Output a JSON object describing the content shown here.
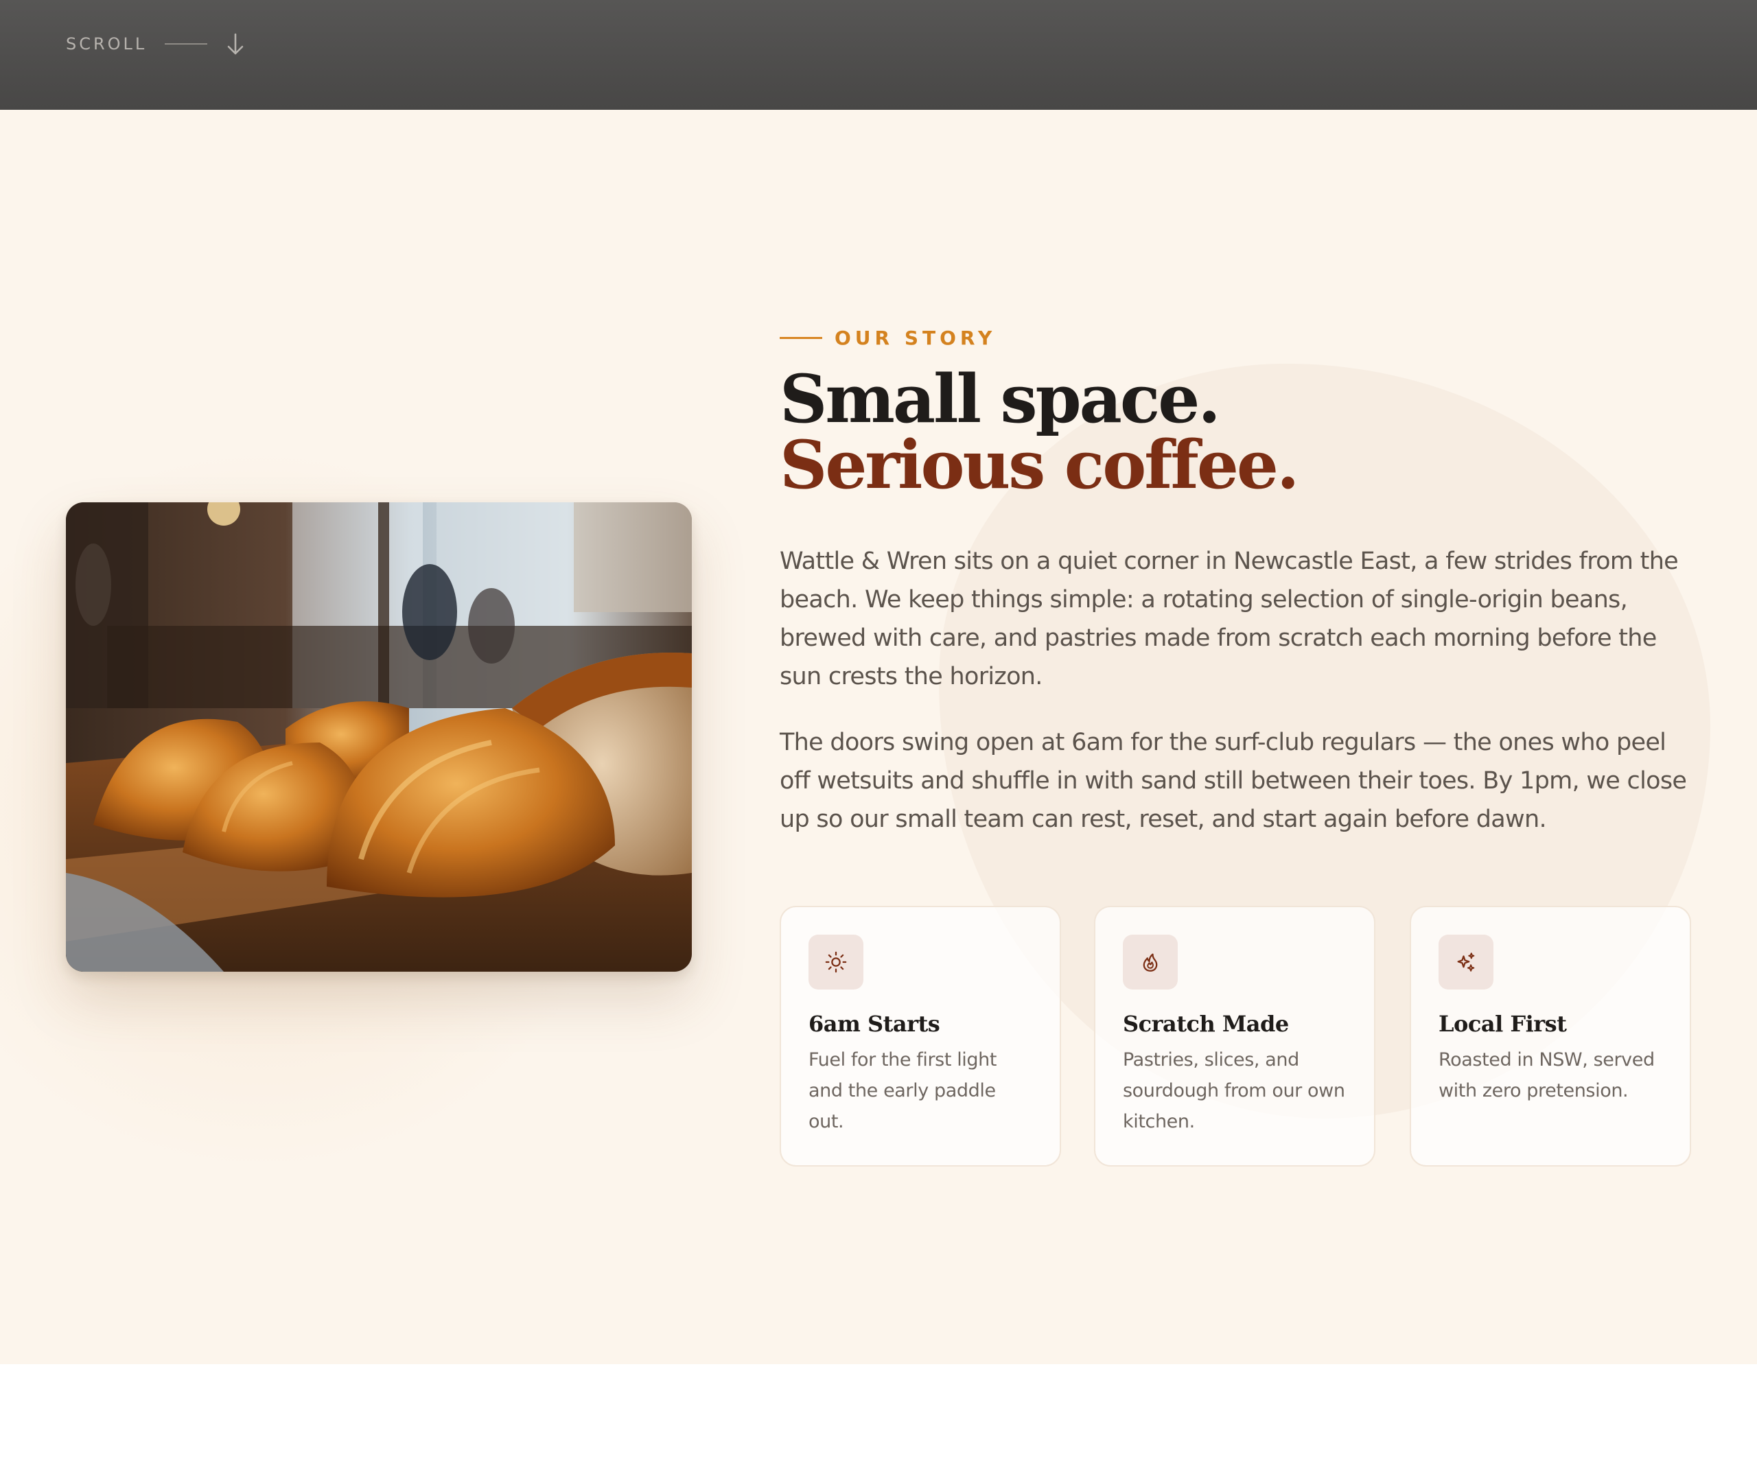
{
  "header": {
    "scroll_label": "SCROLL",
    "scroll_icon": "arrow-down-icon"
  },
  "story": {
    "eyebrow": "OUR STORY",
    "headline_line1": "Small space.",
    "headline_line2": "Serious coffee.",
    "paragraphs": [
      "Wattle & Wren sits on a quiet corner in Newcastle East, a few strides from the beach. We keep things simple: a rotating selection of single-origin beans, brewed with care, and pastries made from scratch each morning before the sun crests the horizon.",
      "The doors swing open at 6am for the surf-club regulars — the ones who peel off wetsuits and shuffle in with sand still between their toes. By 1pm, we close up so our small team can rest, reset, and start again before dawn."
    ],
    "image": {
      "subject": "croissants and bread on a wooden board in a cafe",
      "icon": "photo-croissants"
    },
    "features": [
      {
        "icon": "sun-icon",
        "title": "6am Starts",
        "text": "Fuel for the first light and the early paddle out."
      },
      {
        "icon": "flame-icon",
        "title": "Scratch Made",
        "text": "Pastries, slices, and sourdough from our own kitchen."
      },
      {
        "icon": "sparkles-icon",
        "title": "Local First",
        "text": "Roasted in NSW, served with zero pretension."
      }
    ]
  },
  "colors": {
    "accent": "#d4821f",
    "brand_dark": "#7b2e14",
    "background": "#fcf5ec",
    "topbar": "#4f4e4d"
  }
}
